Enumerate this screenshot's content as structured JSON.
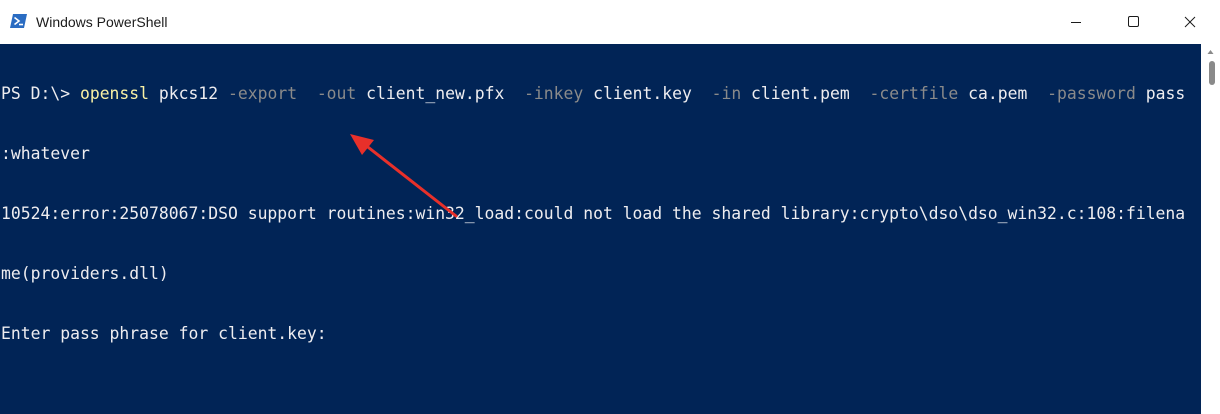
{
  "window": {
    "title": "Windows PowerShell",
    "controls": {
      "minimize": "minimize-icon",
      "maximize": "maximize-icon",
      "close": "close-icon"
    }
  },
  "console": {
    "prompt": "PS D:\\> ",
    "command": "openssl",
    "tokens": [
      {
        "text": " pkcs12 ",
        "kind": "arg"
      },
      {
        "text": "-export",
        "kind": "param"
      },
      {
        "text": "  ",
        "kind": "arg"
      },
      {
        "text": "-out",
        "kind": "param"
      },
      {
        "text": " client_new.pfx  ",
        "kind": "arg"
      },
      {
        "text": "-inkey",
        "kind": "param"
      },
      {
        "text": " client.key  ",
        "kind": "arg"
      },
      {
        "text": "-in",
        "kind": "param"
      },
      {
        "text": " client.pem  ",
        "kind": "arg"
      },
      {
        "text": "-certfile",
        "kind": "param"
      },
      {
        "text": " ca.pem  ",
        "kind": "arg"
      },
      {
        "text": "-password",
        "kind": "param"
      },
      {
        "text": " pass",
        "kind": "arg"
      }
    ],
    "line2": ":whatever",
    "line3": "10524:error:25078067:DSO support routines:win32_load:could not load the shared library:crypto\\dso\\dso_win32.c:108:filena",
    "line4": "me(providers.dll)",
    "line5": "Enter pass phrase for client.key:"
  },
  "colors": {
    "background": "#012456",
    "text": "#eeedf0",
    "command": "#f9f1a5",
    "parameter": "#8a8a8a",
    "annotation_arrow": "#e8302a"
  }
}
